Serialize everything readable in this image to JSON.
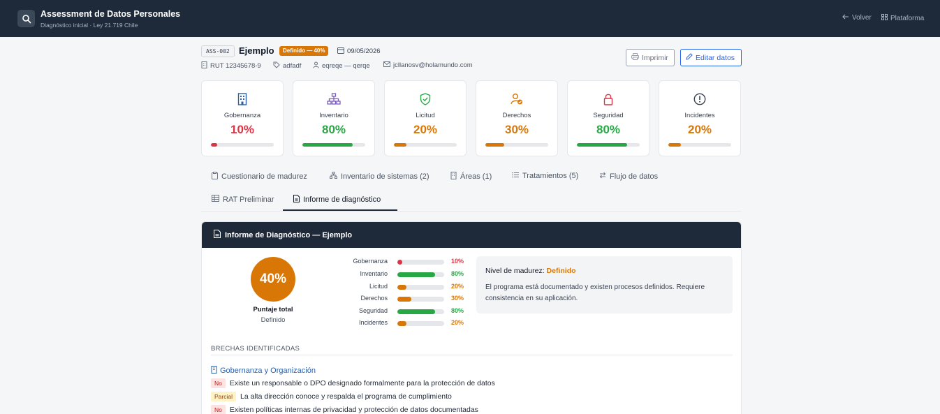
{
  "app": {
    "title": "Assessment de Datos Personales",
    "subtitle": "Diagnóstico inicial · Ley 21.719 Chile",
    "back_label": "Volver",
    "platform_label": "Plataforma"
  },
  "assessment": {
    "code": "ASS-002",
    "name": "Ejemplo",
    "status_badge": "Definido — 40%",
    "date": "09/05/2026",
    "rut": "RUT 12345678-9",
    "tag": "adfadf",
    "contact": "eqreqe — qerqe",
    "email": "jcllanosv@holamundo.com"
  },
  "actions": {
    "print_label": "Imprimir",
    "edit_label": "Editar datos"
  },
  "colors": {
    "red": "#dc3545",
    "green": "#28a745",
    "orange": "#d97706",
    "navy": "#1e2a3a"
  },
  "dimensions": [
    {
      "label": "Gobernanza",
      "value": "10%",
      "pct": 10,
      "level": "red",
      "icon": "building-icon"
    },
    {
      "label": "Inventario",
      "value": "80%",
      "pct": 80,
      "level": "green",
      "icon": "network-icon"
    },
    {
      "label": "Licitud",
      "value": "20%",
      "pct": 20,
      "level": "orange",
      "icon": "shield-check-icon"
    },
    {
      "label": "Derechos",
      "value": "30%",
      "pct": 30,
      "level": "orange",
      "icon": "user-check-icon"
    },
    {
      "label": "Seguridad",
      "value": "80%",
      "pct": 80,
      "level": "green",
      "icon": "lock-icon"
    },
    {
      "label": "Incidentes",
      "value": "20%",
      "pct": 20,
      "level": "orange",
      "icon": "alert-circle-icon"
    }
  ],
  "tabs": [
    {
      "label": "Cuestionario de madurez"
    },
    {
      "label": "Inventario de sistemas (2)"
    },
    {
      "label": "Áreas (1)"
    },
    {
      "label": "Tratamientos (5)"
    },
    {
      "label": "Flujo de datos"
    },
    {
      "label": "RAT Preliminar"
    },
    {
      "label": "Informe de diagnóstico",
      "active": true
    }
  ],
  "report": {
    "title": "Informe de Diagnóstico — Ejemplo",
    "total_score": "40%",
    "total_label": "Puntaje total",
    "total_level": "Definido",
    "maturity_prefix": "Nivel de madurez:",
    "maturity_level": "Definido",
    "maturity_description": "El programa está documentado y existen procesos definidos. Requiere consistencia en su aplicación.",
    "gaps_title": "BRECHAS IDENTIFICADAS",
    "gap_groups": [
      {
        "title": "Gobernanza y Organización",
        "items": [
          {
            "status": "No",
            "text": "Existe un responsable o DPO designado formalmente para la protección de datos"
          },
          {
            "status": "Parcial",
            "text": "La alta dirección conoce y respalda el programa de cumplimiento"
          },
          {
            "status": "No",
            "text": "Existen políticas internas de privacidad y protección de datos documentadas"
          }
        ]
      }
    ]
  }
}
